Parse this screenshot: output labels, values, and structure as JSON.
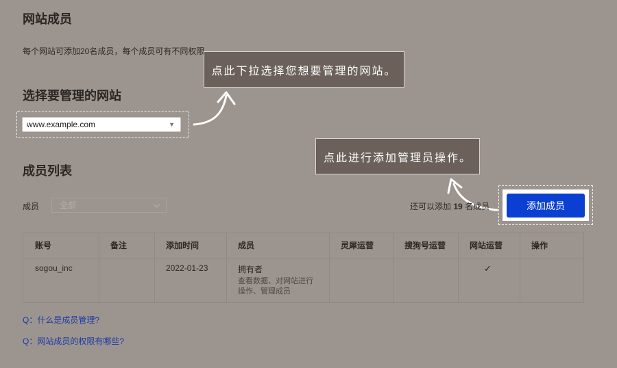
{
  "header": {
    "title": "网站成员",
    "subtitle": "每个网站可添加20名成员，每个成员可有不同权限"
  },
  "site_selector": {
    "heading": "选择要管理的网站",
    "value": "www.example.com"
  },
  "tooltips": {
    "site_tip": "点此下拉选择您想要管理的网站。",
    "add_tip": "点此进行添加管理员操作。"
  },
  "members": {
    "heading": "成员列表",
    "filter_label": "成员",
    "filter_value": "全部",
    "remaining_prefix": "还可以添加",
    "remaining_count": "19",
    "remaining_suffix": "名成员",
    "add_button": "添加成员"
  },
  "table": {
    "headers": [
      "账号",
      "备注",
      "添加时间",
      "成员",
      "灵犀运营",
      "搜狗号运营",
      "网站运营",
      "操作"
    ],
    "rows": [
      {
        "account": "sogou_inc",
        "note": "",
        "added": "2022-01-23",
        "member_role": "拥有者",
        "member_desc": "查看数据、对网站进行操作、管理成员",
        "lingxi": "",
        "sogou_ops": "",
        "site_ops": "✓",
        "action": ""
      }
    ]
  },
  "faq": [
    "Q：什么是成员管理?",
    "Q：网站成员的权限有哪些?"
  ],
  "colors": {
    "background": "#9c948f",
    "primary_button": "#0a3fd1",
    "tooltip_bg": "#6b615a",
    "link": "#1b3aa6"
  }
}
